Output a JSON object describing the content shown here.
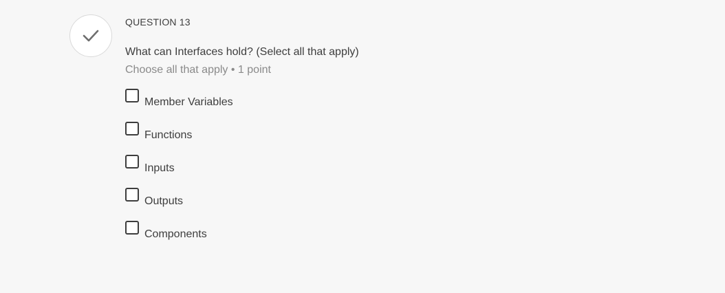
{
  "question": {
    "status_icon": "checkmark-icon",
    "number_label": "QUESTION 13",
    "prompt": "What can Interfaces hold? (Select all that apply)",
    "meta": "Choose all that apply • 1 point",
    "options": [
      {
        "label": "Member Variables",
        "checked": false
      },
      {
        "label": "Functions",
        "checked": false
      },
      {
        "label": "Inputs",
        "checked": false
      },
      {
        "label": "Outputs",
        "checked": false
      },
      {
        "label": "Components",
        "checked": false
      }
    ]
  },
  "colors": {
    "background": "#f7f7f7",
    "text": "#3d3d3d",
    "muted_text": "#8a8a8a",
    "status_border": "#d9d9d9",
    "checkmark": "#6e6e6e"
  }
}
